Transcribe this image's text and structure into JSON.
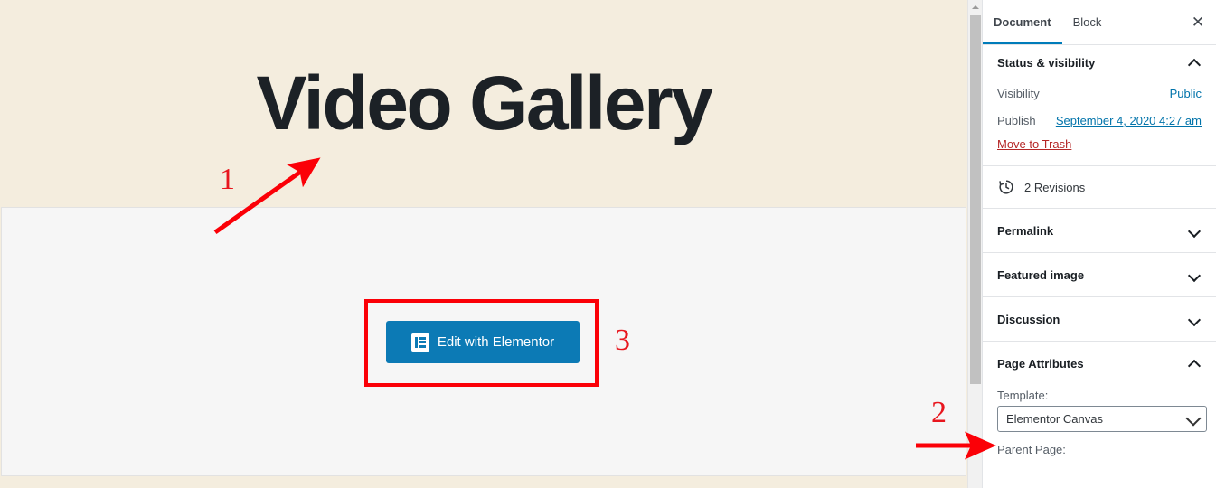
{
  "canvas": {
    "post_title": "Video Gallery",
    "elementor_button": {
      "label": "Edit with Elementor",
      "icon": "elementor-icon",
      "color": "#0c7ab5"
    },
    "header_bg": "#f4edde",
    "content_bg": "#f6f6f6"
  },
  "annotations": {
    "color": "#e8161e",
    "markers": [
      {
        "num": "1",
        "target": "post-title"
      },
      {
        "num": "2",
        "target": "template-select"
      },
      {
        "num": "3",
        "target": "edit-with-elementor-button"
      }
    ]
  },
  "scrollbar": {
    "up_arrow": "triangle-up-icon",
    "thumb_color": "#c1c1c1"
  },
  "sidebar": {
    "tabs": [
      {
        "label": "Document",
        "active": true
      },
      {
        "label": "Block",
        "active": false
      }
    ],
    "close_icon": "close-icon",
    "close_glyph": "✕",
    "panels": [
      {
        "title": "Status & visibility",
        "expanded": true,
        "rows": [
          {
            "label": "Visibility",
            "value": "Public",
            "is_link": true
          },
          {
            "label": "Publish",
            "value": "September 4, 2020 4:27 am",
            "is_link": true
          }
        ],
        "trash_label": "Move to Trash"
      },
      {
        "title": "2 Revisions",
        "type": "revisions",
        "icon": "clock-history-icon"
      },
      {
        "title": "Permalink",
        "expanded": false
      },
      {
        "title": "Featured image",
        "expanded": false
      },
      {
        "title": "Discussion",
        "expanded": false
      },
      {
        "title": "Page Attributes",
        "expanded": true,
        "template_label": "Template:",
        "template_value": "Elementor Canvas",
        "parent_label": "Parent Page:"
      }
    ],
    "accent_color": "#007cba",
    "link_color": "#0073aa",
    "trash_color": "#b52727"
  }
}
